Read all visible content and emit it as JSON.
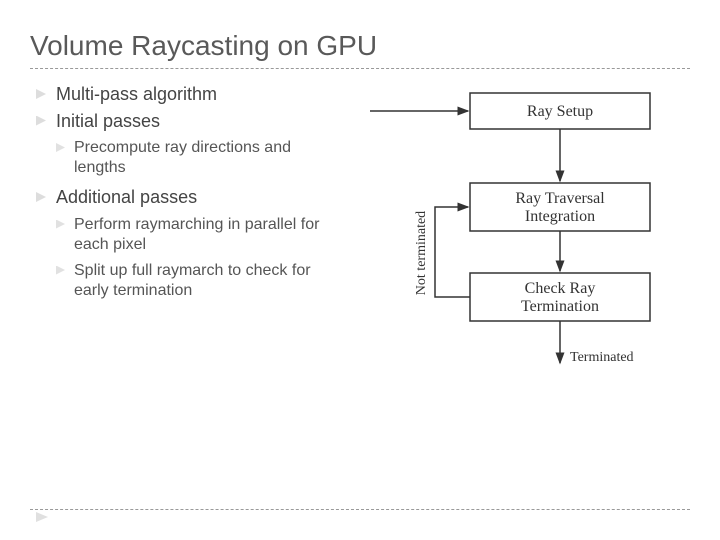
{
  "title": "Volume Raycasting on GPU",
  "bullets": {
    "b1": "Multi-pass algorithm",
    "b2": "Initial passes",
    "b2_1": "Precompute ray directions and lengths",
    "b3": "Additional passes",
    "b3_1": "Perform raymarching in parallel for each pixel",
    "b3_2": "Split up full raymarch to check for early termination"
  },
  "diagram": {
    "box1": "Ray Setup",
    "box2_l1": "Ray Traversal",
    "box2_l2": "Integration",
    "box3_l1": "Check Ray",
    "box3_l2": "Termination",
    "label_not_terminated": "Not terminated",
    "label_terminated": "Terminated"
  }
}
